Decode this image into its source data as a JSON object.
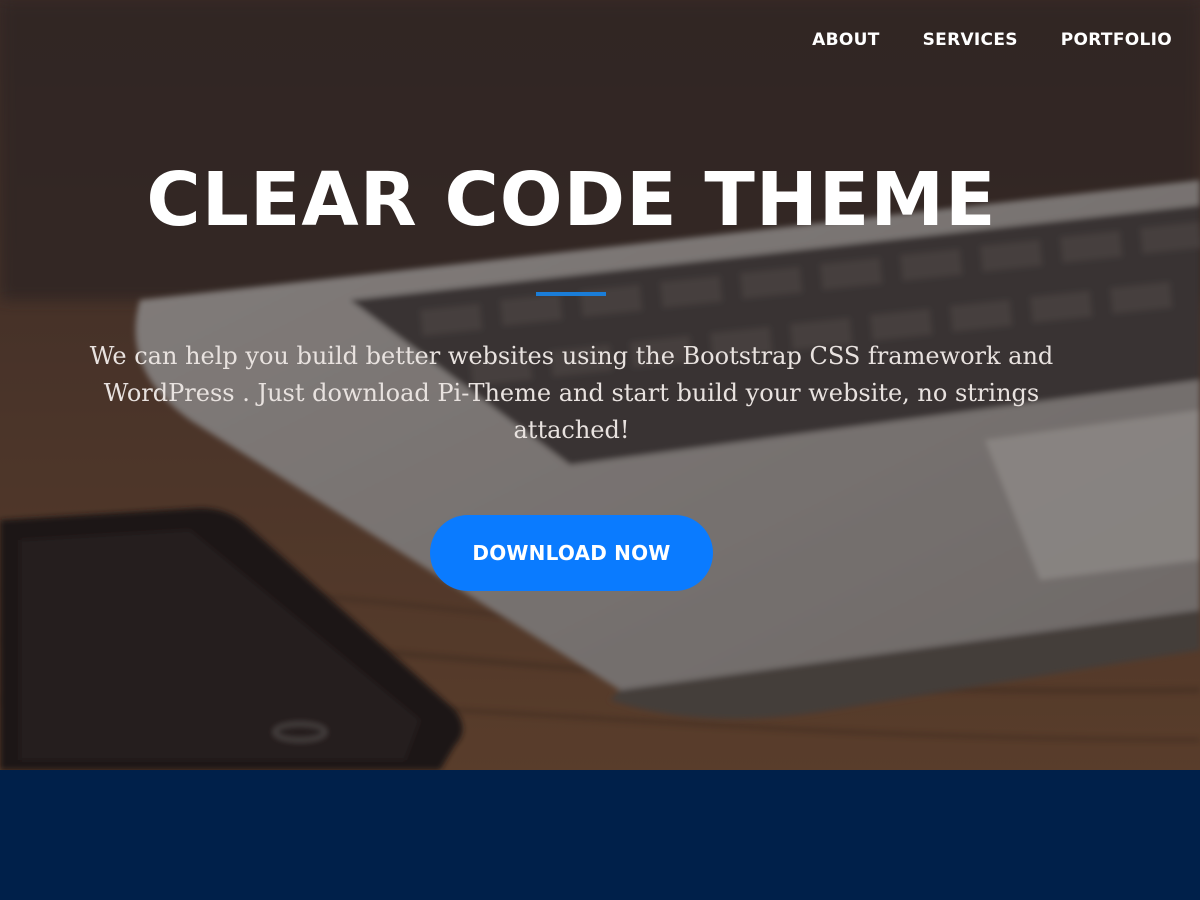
{
  "nav": {
    "items": [
      {
        "label": "ABOUT"
      },
      {
        "label": "SERVICES"
      },
      {
        "label": "PORTFOLIO"
      }
    ]
  },
  "hero": {
    "title": "CLEAR CODE THEME",
    "subtitle": "We can help you build better websites using the Bootstrap CSS framework and WordPress . Just download Pi-Theme and start build your website, no strings attached!",
    "cta_label": "DOWNLOAD NOW"
  },
  "colors": {
    "accent": "#0a7bff",
    "divider": "#1a7dd8",
    "bottom_band": "#00204a"
  }
}
